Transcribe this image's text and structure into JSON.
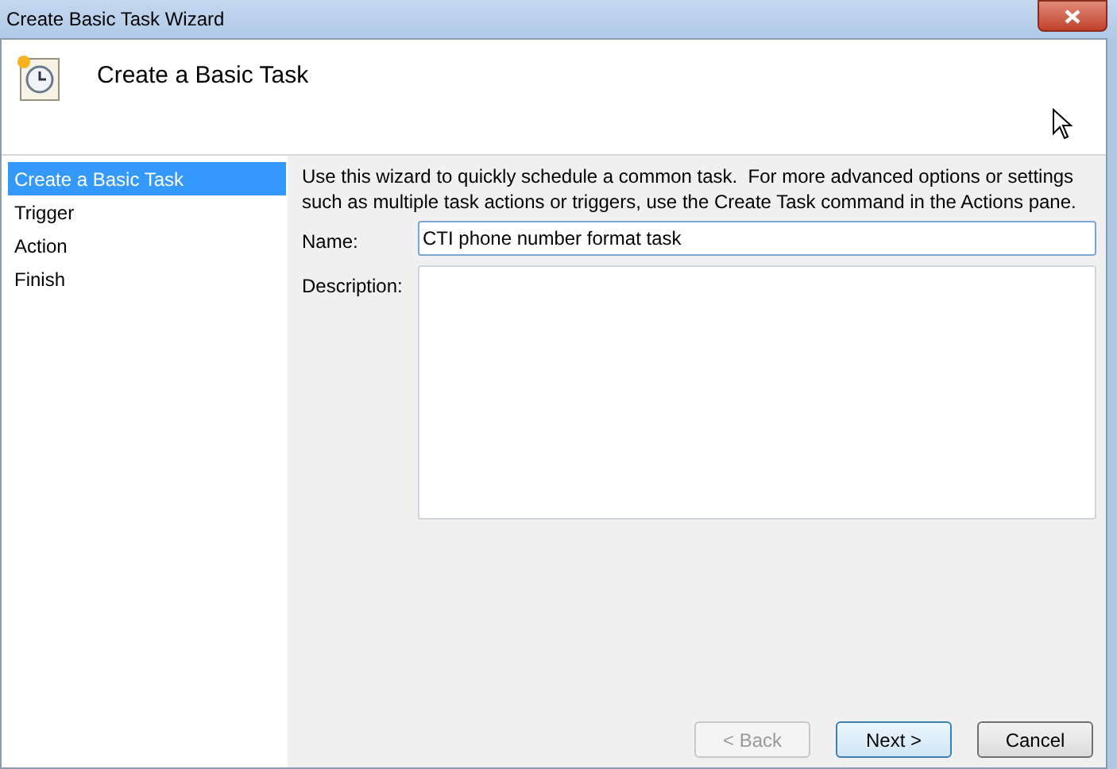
{
  "window": {
    "title": "Create Basic Task Wizard"
  },
  "header": {
    "title": "Create a Basic Task"
  },
  "steps": [
    {
      "label": "Create a Basic Task",
      "selected": true
    },
    {
      "label": "Trigger",
      "selected": false
    },
    {
      "label": "Action",
      "selected": false
    },
    {
      "label": "Finish",
      "selected": false
    }
  ],
  "intro": "Use this wizard to quickly schedule a common task.  For more advanced options or settings such as multiple task actions or triggers, use the Create Task command in the Actions pane.",
  "fields": [
    {
      "label": "Name:",
      "value": "CTI phone number format task",
      "kind": "line"
    },
    {
      "label": "Description:",
      "kind": "area"
    }
  ],
  "buttons": [
    {
      "label": "< Back",
      "disabled": true,
      "default": false
    },
    {
      "label": "Next >",
      "disabled": false,
      "default": true
    },
    {
      "label": "Cancel",
      "disabled": false,
      "default": false
    }
  ]
}
